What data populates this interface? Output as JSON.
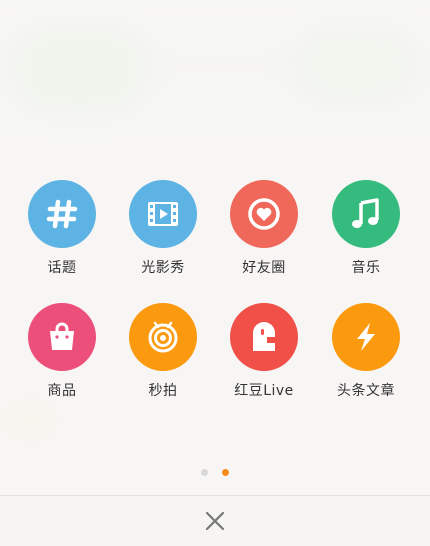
{
  "menu": {
    "items": [
      {
        "label": "话题",
        "icon": "hashtag-icon",
        "color": "#5db3e3"
      },
      {
        "label": "光影秀",
        "icon": "film-icon",
        "color": "#5db3e3"
      },
      {
        "label": "好友圈",
        "icon": "heart-icon",
        "color": "#f0685a"
      },
      {
        "label": "音乐",
        "icon": "music-note-icon",
        "color": "#34bb7d"
      },
      {
        "label": "商品",
        "icon": "shopping-bag-icon",
        "color": "#ec4f7a"
      },
      {
        "label": "秒拍",
        "icon": "camera-lens-icon",
        "color": "#fb9a0e"
      },
      {
        "label": "红豆Live",
        "icon": "live-mascot-icon",
        "color": "#f05048"
      },
      {
        "label": "头条文章",
        "icon": "lightning-icon",
        "color": "#fb9a0e"
      }
    ]
  },
  "pagination": {
    "pages": 2,
    "active": 2,
    "active_color": "#f28c1c"
  },
  "close": {
    "icon": "close-icon"
  }
}
